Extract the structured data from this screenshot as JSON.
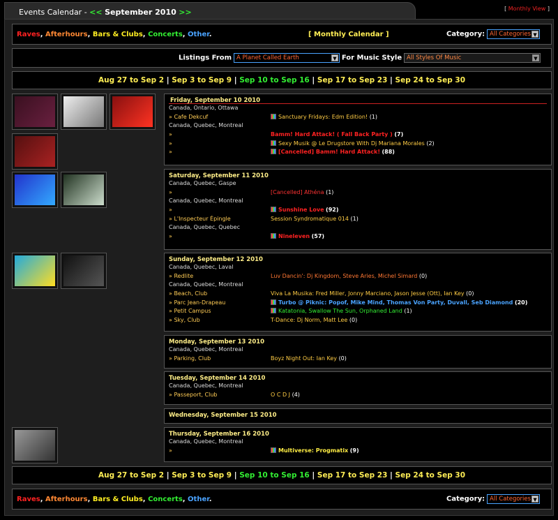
{
  "header": {
    "title_prefix": "Events Calendar - ",
    "prev": "<<",
    "month": "September 2010",
    "next": ">>",
    "bracket_open": "[",
    "monthly_view": "Monthly View",
    "bracket_close": "]"
  },
  "categories": {
    "raves": "Raves",
    "afterhours": "Afterhours",
    "bars": "Bars & Clubs",
    "concerts": "Concerts",
    "other": "Other",
    "sep": ", ",
    "end": "."
  },
  "top_bar": {
    "monthly_calendar": "[ Monthly Calendar ]",
    "category_label": "Category:",
    "category_value": "All Categories"
  },
  "filters": {
    "listings_label": "Listings From",
    "listings_value": "A Planet Called Earth",
    "style_label": "For Music Style",
    "style_value": "All Styles Of Music"
  },
  "weeks": [
    {
      "label": "Aug 27 to Sep 2",
      "current": false
    },
    {
      "label": "Sep 3 to Sep 9",
      "current": false
    },
    {
      "label": "Sep 10 to Sep 16",
      "current": true
    },
    {
      "label": "Sep 17 to Sep 23",
      "current": false
    },
    {
      "label": "Sep 24 to Sep 30",
      "current": false
    }
  ],
  "week_sep": " | ",
  "days": {
    "fri": {
      "title": "Friday, September 10 2010",
      "rows": [
        {
          "loc": "Canada, Ontario, Ottawa"
        },
        {
          "venue": "» Cafe Dekcuf",
          "icon": true,
          "event": "Sanctuary Fridays: Edm Edition!",
          "cls": "y",
          "count": "(1)"
        },
        {
          "loc": "Canada, Quebec, Montreal"
        },
        {
          "venue": "»",
          "icon": false,
          "event": "Bamm! Hard Attack! ( Fall Back Party )",
          "cls": "r",
          "count": "(7)",
          "bold": true
        },
        {
          "venue": "»",
          "icon": true,
          "event": "Sexy Musik @ Le Drugstore With Dj Mariana Morales",
          "cls": "y",
          "count": "(2)"
        },
        {
          "venue": "»",
          "icon": true,
          "event": "[Cancelled] Bamm! Hard Attack!",
          "cls": "r",
          "count": "(88)",
          "bold": true
        }
      ]
    },
    "sat": {
      "title": "Saturday, September 11 2010",
      "rows": [
        {
          "loc": "Canada, Quebec, Gaspe"
        },
        {
          "venue": "»",
          "icon": false,
          "event": "[Cancelled] Athéna",
          "cls": "rn",
          "count": "(1)"
        },
        {
          "loc": "Canada, Quebec, Montreal"
        },
        {
          "venue": "»",
          "icon": true,
          "event": "Sunshine Love",
          "cls": "r",
          "count": "(92)",
          "bold": true
        },
        {
          "venue": "» L'Inspecteur Épingle",
          "icon": false,
          "event": "Session Syndromatique 014",
          "cls": "y",
          "count": "(1)"
        },
        {
          "loc": "Canada, Quebec, Quebec"
        },
        {
          "venue": "»",
          "icon": true,
          "event": "Nineleven",
          "cls": "r",
          "count": "(57)",
          "bold": true
        }
      ]
    },
    "sun": {
      "title": "Sunday, September 12 2010",
      "rows": [
        {
          "loc": "Canada, Quebec, Laval"
        },
        {
          "venue": "» Redlite",
          "icon": false,
          "event": "Luv Dancin': Dj Kingdom, Steve Aries, Michel Simard",
          "cls": "o",
          "count": "(0)"
        },
        {
          "loc": "Canada, Quebec, Montreal"
        },
        {
          "venue": "» Beach, Club",
          "icon": false,
          "event": "Viva La Musika: Fred Miller, Jonny Marciano, Jason Jesse (Ott), Ian Key",
          "cls": "y",
          "count": "(0)"
        },
        {
          "venue": "» Parc Jean-Drapeau",
          "icon": true,
          "event": "Turbo @ Piknic: Popof, Mike Mind, Thomas Von Party, Duvall, Seb Diamond",
          "cls": "bl",
          "count": "(20)",
          "bold": true
        },
        {
          "venue": "» Petit Campus",
          "icon": true,
          "event": "Katatonia, Swallow The Sun, Orphaned Land",
          "cls": "gr",
          "count": "(1)"
        },
        {
          "venue": "» Sky, Club",
          "icon": false,
          "event": "T-Dance: Dj Norm, Matt Lee",
          "cls": "y",
          "count": "(0)"
        }
      ]
    },
    "mon": {
      "title": "Monday, September 13 2010",
      "rows": [
        {
          "loc": "Canada, Quebec, Montreal"
        },
        {
          "venue": "» Parking, Club",
          "icon": false,
          "event": "Boyz Night Out: Ian Key",
          "cls": "y",
          "count": "(0)"
        }
      ]
    },
    "tue": {
      "title": "Tuesday, September 14 2010",
      "rows": [
        {
          "loc": "Canada, Quebec, Montreal"
        },
        {
          "venue": "» Passeport, Club",
          "icon": false,
          "event": "O C D J",
          "cls": "y",
          "count": "(4)"
        }
      ]
    },
    "wed": {
      "title": "Wednesday, September 15 2010",
      "rows": []
    },
    "thu": {
      "title": "Thursday, September 16 2010",
      "rows": [
        {
          "loc": "Canada, Quebec, Montreal"
        },
        {
          "venue": "»",
          "icon": true,
          "event": "Multiverse: Progmatix",
          "cls": "yb",
          "count": "(9)",
          "bold": true
        }
      ]
    }
  },
  "thumbs": [
    {
      "name": "flyer-ceremonial-thumb",
      "colors": [
        "#3a1020",
        "#6a2040"
      ]
    },
    {
      "name": "flyer-white-figure-thumb",
      "colors": [
        "#eeeeee",
        "#777777"
      ]
    },
    {
      "name": "flyer-bamm-thumb",
      "colors": [
        "#881010",
        "#ff3322"
      ]
    },
    {
      "name": "flyer-red-party-thumb",
      "colors": [
        "#551010",
        "#aa2222"
      ]
    },
    {
      "name": "flyer-sunshine-love-thumb",
      "colors": [
        "#2233cc",
        "#33aaff"
      ]
    },
    {
      "name": "flyer-nineleven-thumb",
      "colors": [
        "#223322",
        "#ccddcc"
      ]
    },
    {
      "name": "flyer-turbo-piknic-thumb",
      "colors": [
        "#22aadd",
        "#ffdd22"
      ]
    },
    {
      "name": "flyer-katatonia-thumb",
      "colors": [
        "#111111",
        "#555555"
      ]
    },
    {
      "name": "flyer-progmatix-thumb",
      "colors": [
        "#999999",
        "#333333"
      ]
    }
  ]
}
